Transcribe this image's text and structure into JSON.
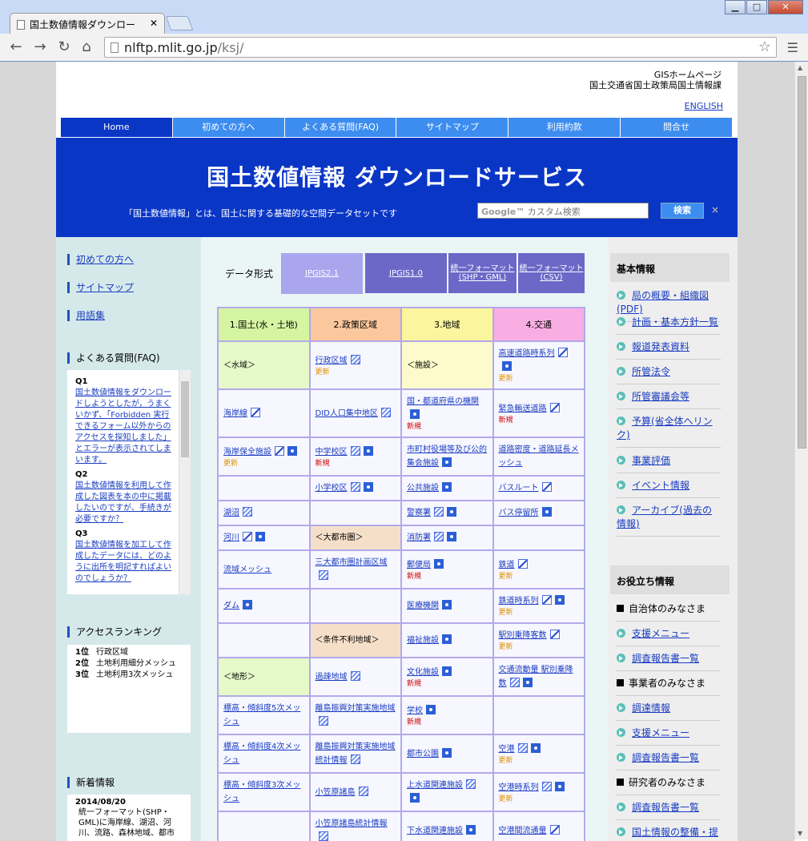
{
  "browser": {
    "tab_title": "国土数値情報ダウンロー",
    "url_host": "nlftp.mlit.go.jp",
    "url_path": "/ksj/"
  },
  "header": {
    "line1": "GISホームページ",
    "line2": "国土交通省国土政策局国土情報課",
    "english": "ENGLISH"
  },
  "gnav": [
    "Home",
    "初めての方へ",
    "よくある質問(FAQ)",
    "サイトマップ",
    "利用約款",
    "問合せ"
  ],
  "banner": {
    "title": "国土数値情報  ダウンロードサービス",
    "desc": "「国土数値情報」とは、国土に関する基礎的な空間データセットです",
    "search_placeholder": "カスタム検索",
    "search_brand": "Google™",
    "search_button": "検索",
    "clear": "×"
  },
  "left": {
    "links": [
      "初めての方へ",
      "サイトマップ",
      "用語集"
    ],
    "faq_head": "よくある質問(FAQ)",
    "faq": [
      {
        "q": "Q1",
        "a": "国土数値情報をダウンロードしようとしたが，うまくいかず、「Forbidden 実行できるフォーム以外からのアクセスを探知しました」とエラーが表示されてしまいます。"
      },
      {
        "q": "Q2",
        "a": "国土数値情報を利用して作成した図表を本の中に掲載したいのですが、手続きが必要ですか？"
      },
      {
        "q": "Q3",
        "a": "国土数値情報を加工して作成したデータには、どのように出所を明記すればよいのでしょうか？"
      }
    ],
    "rank_head": "アクセスランキング",
    "ranking": [
      {
        "rank": "1位",
        "name": "行政区域"
      },
      {
        "rank": "2位",
        "name": "土地利用細分メッシュ"
      },
      {
        "rank": "3位",
        "name": "土地利用3次メッシュ"
      }
    ],
    "news_head": "新着情報",
    "news_date": "2014/08/20",
    "news_text": "統一フォーマット(SHP・GML)に海岸線、湖沼、河川、流路、森林地域、都市"
  },
  "center": {
    "format_label": "データ形式",
    "formats": [
      "JPGIS2.1",
      "JPGIS1.0",
      "統一フォーマット(SHP・GML)",
      "統一フォーマット(CSV)"
    ],
    "columns": [
      "1.国土(水・土地)",
      "2.政策区域",
      "3.地域",
      "4.交通"
    ],
    "update_label": "更新",
    "new_label": "新規"
  },
  "right": {
    "basic_head": "基本情報",
    "basic_links": [
      "局の概要・組織図(PDF)",
      "計画・基本方針一覧",
      "報道発表資料",
      "所管法令",
      "所管審議会等",
      "予算(省全体へリンク)",
      "事業評価",
      "イベント情報",
      "アーカイブ(過去の情報)"
    ],
    "useful_head": "お役立ち情報",
    "useful": [
      {
        "type": "section",
        "label": "自治体のみなさま"
      },
      {
        "type": "link",
        "label": "支援メニュー"
      },
      {
        "type": "link",
        "label": "調査報告書一覧"
      },
      {
        "type": "section",
        "label": "事業者のみなさま"
      },
      {
        "type": "link",
        "label": "調達情報"
      },
      {
        "type": "link",
        "label": "支援メニュー"
      },
      {
        "type": "link",
        "label": "調査報告書一覧"
      },
      {
        "type": "section",
        "label": "研究者のみなさま"
      },
      {
        "type": "link",
        "label": "調査報告書一覧"
      },
      {
        "type": "link",
        "label": "国土情報の整備・提"
      }
    ]
  },
  "grid_rows": [
    [
      {
        "g": "g1",
        "t": "＜水域＞"
      },
      {
        "name": "行政区域",
        "icons": [
          "hatch"
        ],
        "tag": "upd"
      },
      {
        "g": "g3",
        "t": "＜施設＞"
      },
      {
        "name": "高速道路時系列",
        "icons": [
          "line",
          "point"
        ],
        "tag": "upd"
      }
    ],
    [
      {
        "name": "海岸線",
        "icons": [
          "line"
        ]
      },
      {
        "name": "DID人口集中地区",
        "icons": [
          "hatch"
        ]
      },
      {
        "name": "国・都道府県の機関",
        "icons": [
          "point"
        ],
        "tag": "new"
      },
      {
        "name": "緊急輸送道路",
        "icons": [
          "line"
        ],
        "tag": "new"
      }
    ],
    [
      {
        "name": "海岸保全施設",
        "icons": [
          "line",
          "point"
        ],
        "tag": "upd"
      },
      {
        "name": "中学校区",
        "icons": [
          "hatch",
          "point"
        ],
        "tag": "new"
      },
      {
        "name": "市町村役場等及び公的集会施設",
        "icons": [
          "point"
        ]
      },
      {
        "name": "道路密度・道路延長メッシュ",
        "icons": []
      }
    ],
    [
      {},
      {
        "name": "小学校区",
        "icons": [
          "hatch",
          "point"
        ]
      },
      {
        "name": "公共施設",
        "icons": [
          "point"
        ]
      },
      {
        "name": "バスルート",
        "icons": [
          "line"
        ]
      }
    ],
    [
      {
        "name": "湖沼",
        "icons": [
          "hatch"
        ]
      },
      {},
      {
        "name": "警察署",
        "icons": [
          "hatch",
          "point"
        ]
      },
      {
        "name": "バス停留所",
        "icons": [
          "point"
        ]
      }
    ],
    [
      {
        "name": "河川",
        "icons": [
          "line",
          "point"
        ]
      },
      {
        "g": "g2",
        "t": "＜大都市圏＞"
      },
      {
        "name": "消防署",
        "icons": [
          "hatch",
          "point"
        ]
      },
      {}
    ],
    [
      {
        "name": "流域メッシュ",
        "icons": []
      },
      {
        "name": "三大都市圏計画区域",
        "icons": [
          "hatch"
        ]
      },
      {
        "name": "郵便局",
        "icons": [
          "point"
        ],
        "tag": "new"
      },
      {
        "name": "鉄道",
        "icons": [
          "line"
        ],
        "tag": "upd"
      }
    ],
    [
      {
        "name": "ダム",
        "icons": [
          "point"
        ]
      },
      {},
      {
        "name": "医療機関",
        "icons": [
          "point"
        ]
      },
      {
        "name": "鉄道時系列",
        "icons": [
          "line",
          "point"
        ],
        "tag": "upd"
      }
    ],
    [
      {},
      {
        "g": "g2",
        "t": "＜条件不利地域＞"
      },
      {
        "name": "福祉施設",
        "icons": [
          "point"
        ]
      },
      {
        "name": "駅別乗降客数",
        "icons": [
          "line"
        ],
        "tag": "upd"
      }
    ],
    [
      {
        "g": "g1",
        "t": "＜地形＞"
      },
      {
        "name": "過疎地域",
        "icons": [
          "hatch"
        ]
      },
      {
        "name": "文化施設",
        "icons": [
          "point"
        ],
        "tag": "new"
      },
      {
        "name": "交通流動量 駅別乗降数",
        "icons": [
          "hatch",
          "point"
        ]
      }
    ],
    [
      {
        "name": "標高・傾斜度5次メッシュ",
        "icons": []
      },
      {
        "name": "離島振興対策実施地域",
        "icons": [
          "hatch"
        ]
      },
      {
        "name": "学校",
        "icons": [
          "point"
        ],
        "tag": "new"
      },
      {}
    ],
    [
      {
        "name": "標高・傾斜度4次メッシュ",
        "icons": []
      },
      {
        "name": "離島振興対策実施地域統計情報",
        "icons": [
          "hatch"
        ]
      },
      {
        "name": "都市公園",
        "icons": [
          "point"
        ]
      },
      {
        "name": "空港",
        "icons": [
          "hatch",
          "point"
        ],
        "tag": "upd"
      }
    ],
    [
      {
        "name": "標高・傾斜度3次メッシュ",
        "icons": []
      },
      {
        "name": "小笠原諸島",
        "icons": [
          "hatch"
        ]
      },
      {
        "name": "上水道関連施設",
        "icons": [
          "hatch",
          "point"
        ]
      },
      {
        "name": "空港時系列",
        "icons": [
          "hatch",
          "point"
        ],
        "tag": "upd"
      }
    ],
    [
      {},
      {
        "name": "小笠原諸島統計情報",
        "icons": [
          "hatch"
        ]
      },
      {
        "name": "下水道関連施設",
        "icons": [
          "point"
        ]
      },
      {
        "name": "空港間流通量",
        "icons": [
          "line"
        ]
      }
    ]
  ]
}
